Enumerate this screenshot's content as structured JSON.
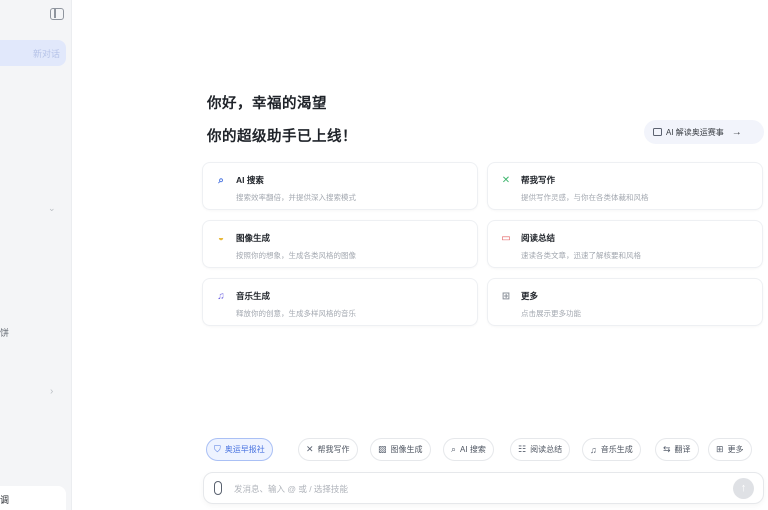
{
  "sidebar": {
    "active_item": "新对话",
    "fragment_label": "饼",
    "bottom_label": "调"
  },
  "greeting": {
    "line1": "你好，幸福的渴望",
    "line2": "你的超级助手已上线！"
  },
  "promo": {
    "label": "AI 解读奥运赛事",
    "arrow": "→"
  },
  "cards": [
    {
      "icon": "search-icon",
      "icon_glyph": "⌕",
      "color": "#4a74e0",
      "title": "AI 搜索",
      "desc": "搜索效率翻倍，并提供深入搜索模式"
    },
    {
      "icon": "writing-icon",
      "icon_glyph": "✕",
      "color": "#3fb66e",
      "title": "帮我写作",
      "desc": "提供写作灵感，与你在各类体裁和风格"
    },
    {
      "icon": "image-icon",
      "icon_glyph": "◒",
      "color": "#e8b93c",
      "title": "图像生成",
      "desc": "按照你的想象，生成各类风格的图像"
    },
    {
      "icon": "reading-icon",
      "icon_glyph": "▭",
      "color": "#e2595a",
      "title": "阅读总结",
      "desc": "速读各类文章，迅速了解核要和风格"
    },
    {
      "icon": "music-icon",
      "icon_glyph": "♫",
      "color": "#6a5ee0",
      "title": "音乐生成",
      "desc": "释放你的创意，生成多样风格的音乐"
    },
    {
      "icon": "more-icon",
      "icon_glyph": "⊞",
      "color": "#8a9099",
      "title": "更多",
      "desc": "点击展示更多功能"
    }
  ],
  "toolbar": [
    {
      "icon": "shield-icon",
      "glyph": "⛉",
      "label": "奥运早报社",
      "active": true
    },
    {
      "icon": "writing-icon",
      "glyph": "✕",
      "label": "帮我写作",
      "active": false
    },
    {
      "icon": "image-icon",
      "glyph": "▨",
      "label": "图像生成",
      "active": false
    },
    {
      "icon": "search-icon",
      "glyph": "⌕",
      "label": "AI 搜索",
      "active": false
    },
    {
      "icon": "reading-icon",
      "glyph": "☷",
      "label": "阅读总结",
      "active": false
    },
    {
      "icon": "music-icon",
      "glyph": "♫",
      "label": "音乐生成",
      "active": false
    },
    {
      "icon": "translate-icon",
      "glyph": "⇆",
      "label": "翻译",
      "active": false
    },
    {
      "icon": "more-icon",
      "glyph": "⊞",
      "label": "更多",
      "active": false
    }
  ],
  "input": {
    "placeholder": "发消息、输入 @ 或 / 选择技能",
    "send_glyph": "↑"
  }
}
